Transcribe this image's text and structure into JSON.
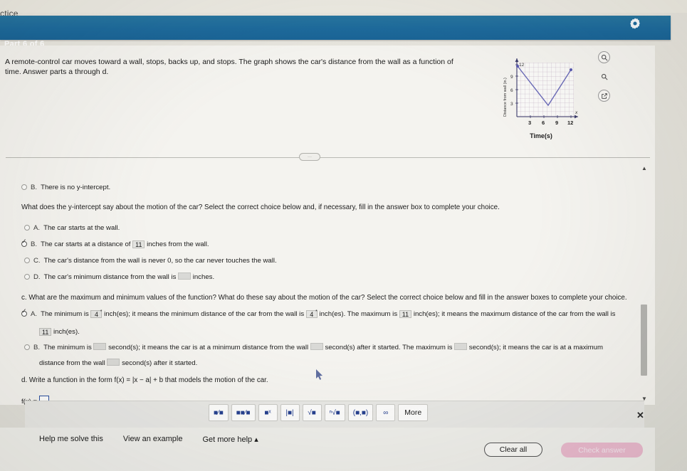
{
  "browser": {
    "tab_label": "ctice"
  },
  "header": {
    "part_label": "Part 6 of 6",
    "gear_icon": "gear-icon",
    "bar_color": "#1d6a9c"
  },
  "question": {
    "body": "A remote-control car moves toward a wall, stops, backs up, and stops. The graph shows the car's distance from the wall as a function of time. Answer parts a through d."
  },
  "graph": {
    "caption": "Time(s)",
    "y_axis_label": "Distance from wall (in.)",
    "x_axis_label": "Time(s)",
    "x_ticks": [
      "3",
      "6",
      "9",
      "12"
    ],
    "y_ticks": [
      "3",
      "6",
      "9",
      "12"
    ],
    "x_axis_letter": "x",
    "tools": [
      {
        "name": "zoom-in-icon",
        "label": "Zoom in"
      },
      {
        "name": "zoom-out-icon",
        "label": "Zoom out"
      },
      {
        "name": "pop-out-icon",
        "label": "Open larger"
      }
    ]
  },
  "chart_data": {
    "type": "line",
    "title": "",
    "xlabel": "Time(s)",
    "ylabel": "Distance from wall (in.)",
    "xlim": [
      0,
      13
    ],
    "ylim": [
      0,
      13
    ],
    "xticks": [
      3,
      6,
      9,
      12
    ],
    "yticks": [
      3,
      6,
      9,
      12
    ],
    "grid": true,
    "series": [
      {
        "name": "Distance from wall",
        "x": [
          0,
          7,
          12
        ],
        "y": [
          11,
          4,
          11
        ],
        "color": "#5b5bb0",
        "markers": [
          {
            "x": 0,
            "y": 11
          },
          {
            "x": 12,
            "y": 11
          }
        ]
      }
    ]
  },
  "divider": {
    "pill_label": "···"
  },
  "part_b_leftover": {
    "radio_label": "B.",
    "text": "There is no y-intercept."
  },
  "prompt_b": "What does the y-intercept say about the motion of the car? Select the correct choice below and, if necessary, fill in the answer box to complete your choice.",
  "choices_b": [
    {
      "letter": "A.",
      "selected": false,
      "parts": [
        {
          "type": "text",
          "value": "The car starts at the wall."
        }
      ]
    },
    {
      "letter": "B.",
      "selected": true,
      "parts": [
        {
          "type": "text",
          "value": "The car starts at a distance of"
        },
        {
          "type": "filled",
          "value": "11"
        },
        {
          "type": "text",
          "value": "inches from the wall."
        }
      ]
    },
    {
      "letter": "C.",
      "selected": false,
      "parts": [
        {
          "type": "text",
          "value": "The car's distance from the wall is never 0, so the car never touches the wall."
        }
      ]
    },
    {
      "letter": "D.",
      "selected": false,
      "parts": [
        {
          "type": "text",
          "value": "The car's minimum distance from the wall is"
        },
        {
          "type": "blank",
          "value": ""
        },
        {
          "type": "text",
          "value": "inches."
        }
      ]
    }
  ],
  "prompt_c": "c. What are the maximum and minimum values of the function? What do these say about the motion of the car? Select the correct choice below and fill in the answer boxes to complete your choice.",
  "choices_c": [
    {
      "letter": "A.",
      "selected": true,
      "line1_a": "The minimum is",
      "val1": "4",
      "line1_b": "inch(es); it means the minimum distance of the car from the wall is",
      "val2": "4",
      "line1_c": "inch(es). The maximum is",
      "val3": "11",
      "line1_d": "inch(es); it means the maximum distance of the car from the wall is",
      "line2_val": "11",
      "line2_tail": "inch(es)."
    },
    {
      "letter": "B.",
      "selected": false,
      "line1_a": "The minimum is",
      "line1_b": "second(s); it means the car is at a minimum distance from the wall",
      "line1_c": "second(s) after it started. The maximum is",
      "line1_d": "second(s); it means the car is at a maximum",
      "line2_a": "distance from the wall",
      "line2_b": "second(s) after it started."
    }
  ],
  "part_d": {
    "prompt_pre": "d. Write a function in the form f(x) = ",
    "prompt_formula": "|x − a| + b",
    "prompt_post": " that models the motion of the car.",
    "answer_label": "f(x) ="
  },
  "math_palette": {
    "buttons": [
      {
        "name": "fraction-button",
        "label": "■⁄■",
        "glyph": "fraction"
      },
      {
        "name": "mixed-number-button",
        "label": "■■⁄■",
        "glyph": "mixed"
      },
      {
        "name": "exponent-button",
        "label": "■ˣ",
        "glyph": "exponent"
      },
      {
        "name": "absolute-value-button",
        "label": "|■|",
        "glyph": "abs"
      },
      {
        "name": "square-root-button",
        "label": "√■",
        "glyph": "sqrt"
      },
      {
        "name": "nth-root-button",
        "label": "ⁿ√■",
        "glyph": "nthroot"
      },
      {
        "name": "interval-button",
        "label": "(■,■)",
        "glyph": "interval"
      },
      {
        "name": "infinity-button",
        "label": "∞",
        "glyph": "infinity"
      },
      {
        "name": "more-button",
        "label": "More",
        "glyph": "more"
      }
    ],
    "close_label": "✕"
  },
  "footer": {
    "links": [
      {
        "name": "help-me-solve-this-link",
        "label": "Help me solve this"
      },
      {
        "name": "view-an-example-link",
        "label": "View an example"
      },
      {
        "name": "get-more-help-link",
        "label": "Get more help ▴"
      }
    ],
    "clear_all_label": "Clear all",
    "check_answer_label": "Check answer",
    "check_answer_color": "#e8b9cd"
  },
  "scrollbar": {
    "up_arrow": "▲",
    "down_arrow": "▼"
  }
}
